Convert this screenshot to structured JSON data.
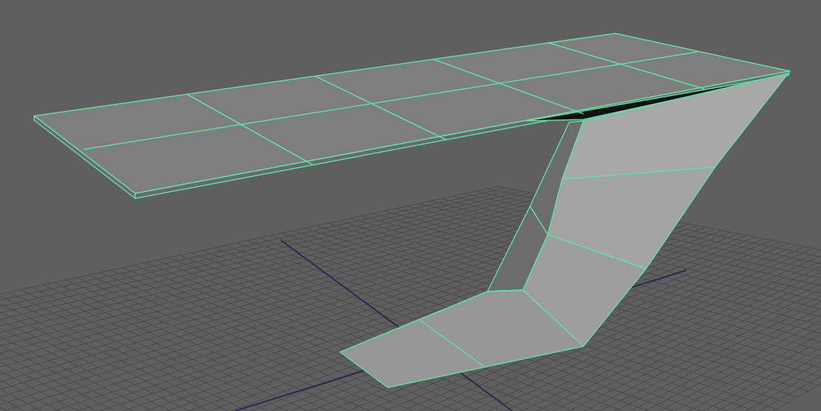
{
  "viewport": {
    "selected": true
  }
}
